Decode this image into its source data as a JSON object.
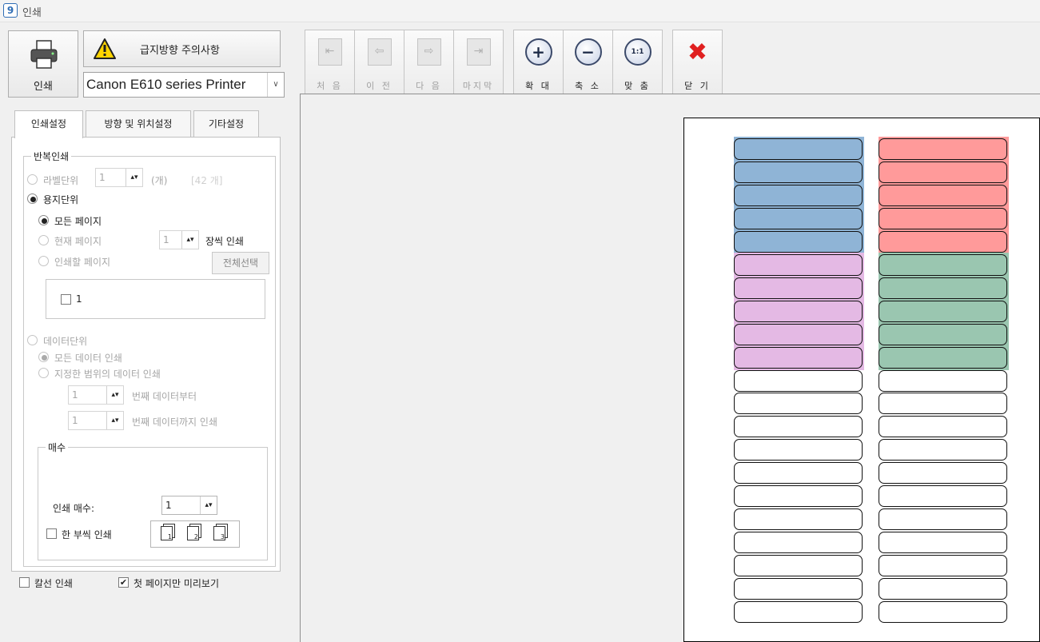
{
  "window": {
    "title": "인쇄",
    "icon": "app-icon"
  },
  "print_button": {
    "label": "인쇄",
    "icon": "printer-icon"
  },
  "warning_button": {
    "label": "급지방향 주의사항",
    "icon": "warning-icon"
  },
  "printer": {
    "selected": "Canon E610 series Printer"
  },
  "tabs": [
    "인쇄설정",
    "방향 및 위치설정",
    "기타설정"
  ],
  "repeat_print": {
    "title": "반복인쇄",
    "label_unit": {
      "label": "라벨단위",
      "value": "1",
      "unit": "(개)",
      "count": "[42 개]"
    },
    "paper_unit": {
      "label": "용지단위",
      "all_pages": "모든 페이지",
      "current_page": "현재 페이지",
      "current_page_value": "1",
      "per_sheet": "장씩 인쇄",
      "pages_to_print": "인쇄할 페이지",
      "select_all": "전체선택",
      "page_items": [
        "1"
      ]
    },
    "data_unit": {
      "label": "데이터단위",
      "all_data": "모든 데이터 인쇄",
      "range_data": "지정한 범위의 데이터 인쇄",
      "from_value": "1",
      "from_label": "번째 데이터부터",
      "to_value": "1",
      "to_label": "번째 데이터까지 인쇄"
    }
  },
  "copies": {
    "title": "매수",
    "label": "인쇄 매수:",
    "value": "1",
    "collate_label": "한 부씩 인쇄",
    "collate_icons": [
      "1",
      "2",
      "3"
    ]
  },
  "bottom": {
    "ruled_print": "칼선 인쇄",
    "first_page_preview": "첫 페이지만 미리보기"
  },
  "toolbar": {
    "nav": [
      {
        "label": "처 음",
        "icon": "first-page-icon"
      },
      {
        "label": "이 전",
        "icon": "prev-page-icon"
      },
      {
        "label": "다 음",
        "icon": "next-page-icon"
      },
      {
        "label": "마지막",
        "icon": "last-page-icon"
      }
    ],
    "zoom": [
      {
        "label": "확 대",
        "icon": "zoom-in-icon",
        "glyph": "+"
      },
      {
        "label": "축 소",
        "icon": "zoom-out-icon",
        "glyph": "−"
      },
      {
        "label": "맞 춤",
        "icon": "fit-icon",
        "glyph": "1:1"
      }
    ],
    "close": {
      "label": "닫 기",
      "icon": "close-icon"
    }
  },
  "preview": {
    "rows": 21,
    "columns": 2,
    "colors": {
      "blue": "#8fb4d6",
      "red": "#ff9a9a",
      "purple": "#e4b9e4",
      "green": "#9ac6b0"
    }
  }
}
